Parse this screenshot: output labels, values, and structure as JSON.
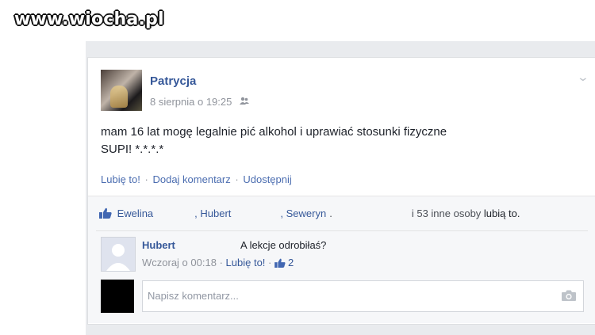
{
  "watermark": "www.wiocha.pl",
  "post": {
    "author": "Patrycja",
    "date": "8 sierpnia o 19:25",
    "privacy_icon": "friends-icon",
    "text_line1": "mam 16 lat mogę legalnie pić alkohol i uprawiać stosunki fizyczne",
    "text_line2": "SUPI! *.*.*.*",
    "options_icon": "chevron-down-icon"
  },
  "actions": {
    "like": "Lubię to!",
    "sep1": "·",
    "comment": "Dodaj komentarz",
    "sep2": "·",
    "share": "Udostępnij"
  },
  "likes": {
    "icon": "thumbs-up-icon",
    "name1": "Ewelina",
    "name2": ", Hubert",
    "name3": ", Seweryn",
    "name3_suffix": ".",
    "rest": "i 53 inne osoby",
    "suffix": "lubią to."
  },
  "comment": {
    "author": "Hubert",
    "text": "A lekcje odrobiłaś?",
    "time": "Wczoraj o 00:18",
    "sep": "·",
    "like": "Lubię to!",
    "sep2": "·",
    "like_count": "2"
  },
  "reply": {
    "placeholder": "Napisz komentarz...",
    "camera_icon": "camera-icon"
  },
  "colors": {
    "link": "#365899",
    "muted": "#90949c",
    "feed_bg": "#e9ebee"
  }
}
